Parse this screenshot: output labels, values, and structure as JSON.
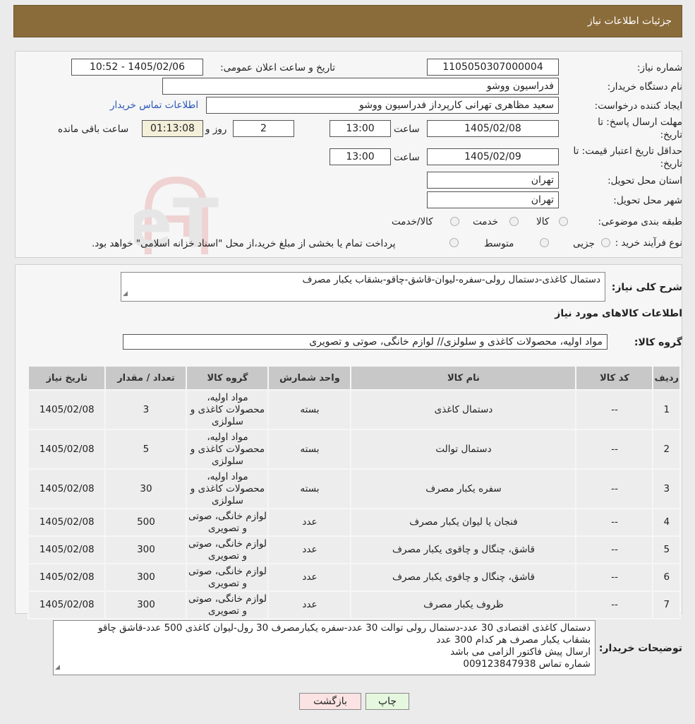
{
  "header": {
    "title": "جزئیات اطلاعات نیاز"
  },
  "form": {
    "need_number_label": "شماره نیاز:",
    "need_number": "1105050307000004",
    "announce_label": "تاریخ و ساعت اعلان عمومی:",
    "announce_value": "1405/02/06 - 10:52",
    "buyer_org_label": "نام دستگاه خریدار:",
    "buyer_org": "فدراسیون ووشو",
    "requester_label": "ایجاد کننده درخواست:",
    "requester": "سعید مظاهری تهرانی کارپرداز فدراسیون ووشو",
    "contact_link": "اطلاعات تماس خریدار",
    "deadline_label_1": "مهلت ارسال پاسخ: تا",
    "deadline_label_2": "تاریخ:",
    "deadline_date": "1405/02/08",
    "time_label": "ساعت",
    "deadline_time": "13:00",
    "days_value": "2",
    "days_label": "روز و",
    "remaining_time": "01:13:08",
    "remaining_label": "ساعت باقی مانده",
    "validity_label_1": "حداقل تاریخ اعتبار قیمت: تا",
    "validity_label_2": "تاریخ:",
    "validity_date": "1405/02/09",
    "validity_time": "13:00",
    "province_label": "استان محل تحویل:",
    "province": "تهران",
    "city_label": "شهر محل تحویل:",
    "city": "تهران",
    "category_label": "طبقه بندی موضوعی:",
    "category_options": [
      "کالا",
      "خدمت",
      "کالا/خدمت"
    ],
    "process_label": "نوع فرآیند خرید :",
    "process_options": [
      "جزیی",
      "متوسط"
    ],
    "process_note": "پرداخت تمام یا بخشی از مبلغ خرید،از محل \"اسناد خزانه اسلامی\" خواهد بود."
  },
  "summary": {
    "label": "شرح کلی نیاز:",
    "value": "دستمال کاغذی-دستمال رولی-سفره-لیوان-قاشق-چاقو-بشقاب یکبار مصرف"
  },
  "goods_section_title": "اطلاعات کالاهای مورد نیاز",
  "goods_group": {
    "label": "گروه کالا:",
    "value": "مواد اولیه، محصولات کاغذی و سلولزی// لوازم خانگی، صوتی و تصویری"
  },
  "table": {
    "headers": [
      "ردیف",
      "کد کالا",
      "نام کالا",
      "واحد شمارش",
      "گروه کالا",
      "تعداد / مقدار",
      "تاریخ نیاز"
    ],
    "rows": [
      [
        "1",
        "--",
        "دستمال کاغذی",
        "بسته",
        "مواد اولیه، محصولات کاغذی و سلولزی",
        "3",
        "1405/02/08"
      ],
      [
        "2",
        "--",
        "دستمال توالت",
        "بسته",
        "مواد اولیه، محصولات کاغذی و سلولزی",
        "5",
        "1405/02/08"
      ],
      [
        "3",
        "--",
        "سفره یکبار مصرف",
        "بسته",
        "مواد اولیه، محصولات کاغذی و سلولزی",
        "30",
        "1405/02/08"
      ],
      [
        "4",
        "--",
        "فنجان یا لیوان یکبار مصرف",
        "عدد",
        "لوازم خانگی، صوتی و تصویری",
        "500",
        "1405/02/08"
      ],
      [
        "5",
        "--",
        "قاشق، چنگال و چاقوی یکبار مصرف",
        "عدد",
        "لوازم خانگی، صوتی و تصویری",
        "300",
        "1405/02/08"
      ],
      [
        "6",
        "--",
        "قاشق، چنگال و چاقوی یکبار مصرف",
        "عدد",
        "لوازم خانگی، صوتی و تصویری",
        "300",
        "1405/02/08"
      ],
      [
        "7",
        "--",
        "ظروف یکبار مصرف",
        "عدد",
        "لوازم خانگی، صوتی و تصویری",
        "300",
        "1405/02/08"
      ]
    ]
  },
  "buyer_notes": {
    "label": "توضیحات خریدار:",
    "lines": [
      "دستمال کاغذی اقتصادی 30 عدد-دستمال رولی توالت 30 عدد-سفره یکبارمصرف 30 رول-لیوان کاغذی 500 عدد-قاشق چاقو",
      "بشقاب یکبار مصرف هر کدام 300 عدد",
      "ارسال پیش فاکتور الزامی می باشد",
      "شماره تماس 009123847938"
    ]
  },
  "buttons": {
    "print": "چاپ",
    "back": "بازگشت"
  },
  "watermark_text": "AriaTender.neT",
  "colors": {
    "header": "#8a6b3a",
    "link": "#2a55b8",
    "back_button": "#fbe3e3",
    "print_button": "#e6f7df"
  }
}
